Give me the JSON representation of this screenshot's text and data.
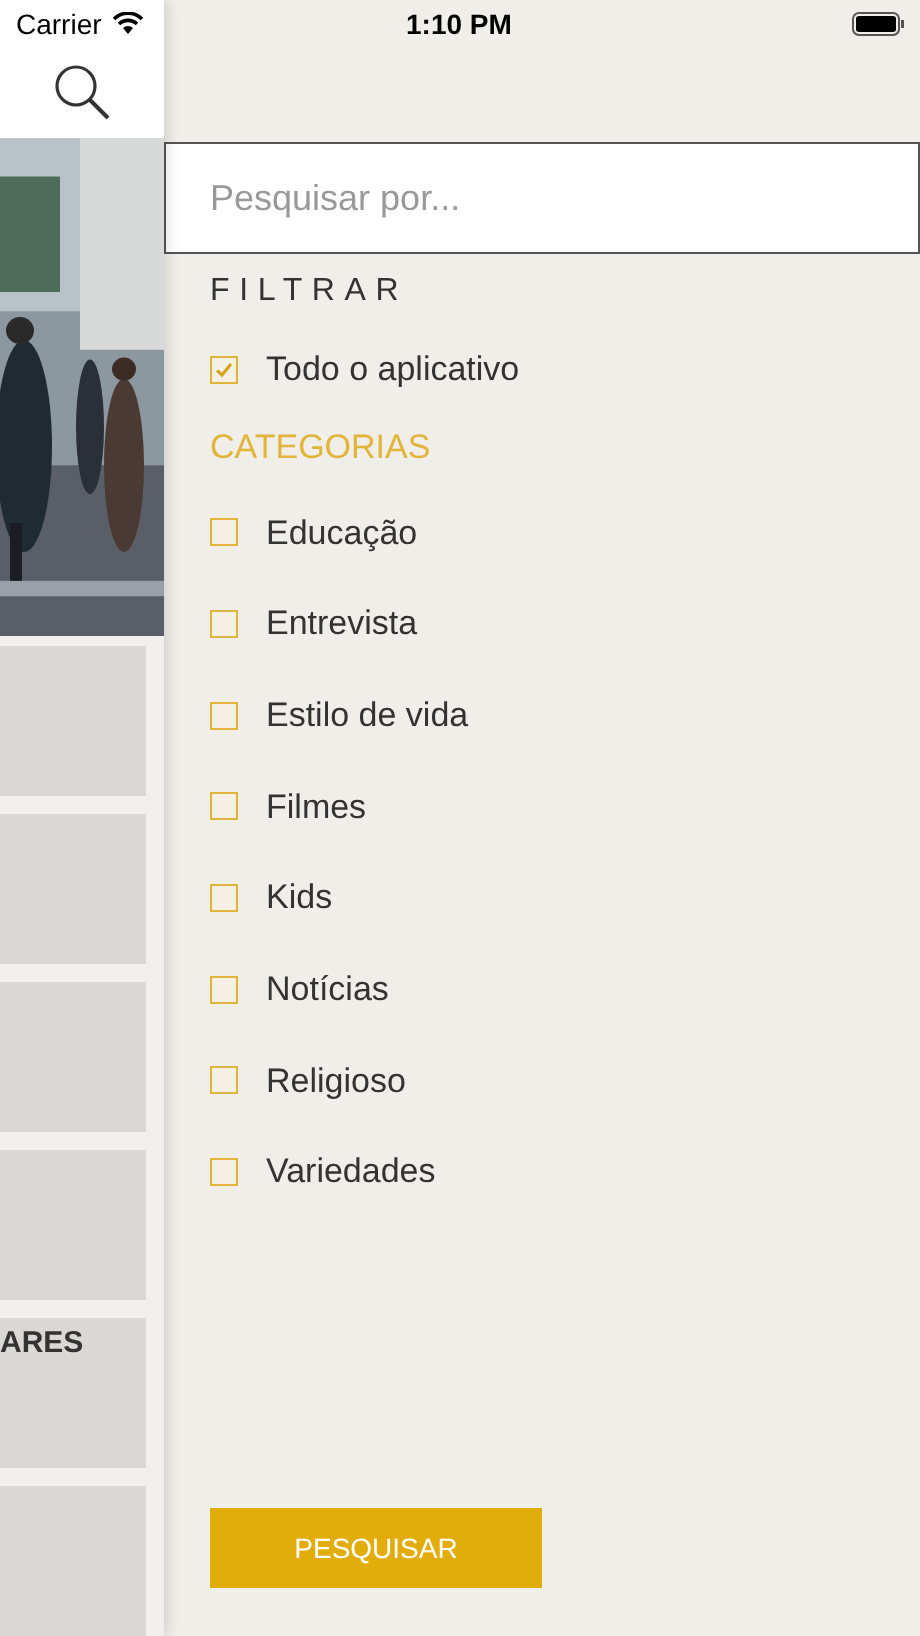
{
  "status_bar": {
    "carrier": "Carrier",
    "time": "1:10 PM"
  },
  "background": {
    "cards": [
      {
        "kind": "plain"
      },
      {
        "kind": "plain"
      },
      {
        "kind": "plain"
      },
      {
        "kind": "plain"
      },
      {
        "kind": "titled",
        "label": "ARES"
      },
      {
        "kind": "plain"
      }
    ]
  },
  "search_field": {
    "placeholder": "Pesquisar por..."
  },
  "filter": {
    "title": "FILTRAR",
    "all_app": {
      "label": "Todo o aplicativo",
      "checked": true
    }
  },
  "categories": {
    "title": "CATEGORIAS",
    "items": [
      {
        "label": "Educação",
        "checked": false
      },
      {
        "label": "Entrevista",
        "checked": false
      },
      {
        "label": "Estilo de vida",
        "checked": false
      },
      {
        "label": "Filmes",
        "checked": false
      },
      {
        "label": "Kids",
        "checked": false
      },
      {
        "label": "Notícias",
        "checked": false
      },
      {
        "label": "Religioso",
        "checked": false
      },
      {
        "label": "Variedades",
        "checked": false
      }
    ]
  },
  "search_button": "PESQUISAR"
}
